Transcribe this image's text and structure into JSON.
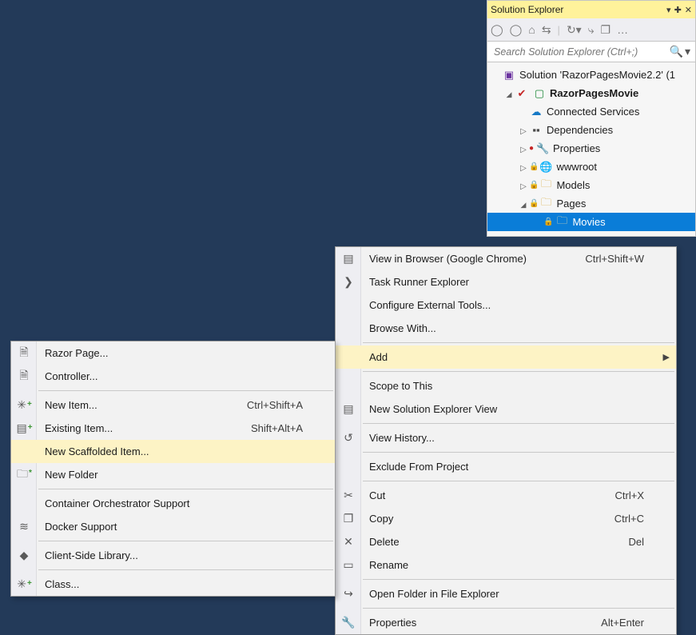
{
  "solutionExplorer": {
    "title": "Solution Explorer",
    "searchPlaceholder": "Search Solution Explorer (Ctrl+;)",
    "tree": {
      "solution": "Solution 'RazorPagesMovie2.2' (1",
      "project": "RazorPagesMovie",
      "connected": "Connected Services",
      "dependencies": "Dependencies",
      "properties": "Properties",
      "wwwroot": "wwwroot",
      "models": "Models",
      "pages": "Pages",
      "movies": "Movies"
    }
  },
  "contextMenu": {
    "viewInBrowser": "View in Browser (Google Chrome)",
    "viewInBrowser_short": "Ctrl+Shift+W",
    "taskRunner": "Task Runner Explorer",
    "configureExternal": "Configure External Tools...",
    "browseWith": "Browse With...",
    "add": "Add",
    "scope": "Scope to This",
    "newSolExplorer": "New Solution Explorer View",
    "viewHistory": "View History...",
    "excludeFromProject": "Exclude From Project",
    "cut": "Cut",
    "cut_short": "Ctrl+X",
    "copy": "Copy",
    "copy_short": "Ctrl+C",
    "delete": "Delete",
    "delete_short": "Del",
    "rename": "Rename",
    "openInExplorer": "Open Folder in File Explorer",
    "properties": "Properties",
    "properties_short": "Alt+Enter"
  },
  "addSub": {
    "razorPage": "Razor Page...",
    "controller": "Controller...",
    "newItem": "New Item...",
    "newItem_short": "Ctrl+Shift+A",
    "existingItem": "Existing Item...",
    "existingItem_short": "Shift+Alt+A",
    "newScaffolded": "New Scaffolded Item...",
    "newFolder": "New Folder",
    "containerOrch": "Container Orchestrator Support",
    "dockerSupport": "Docker Support",
    "clientSideLib": "Client-Side Library...",
    "class": "Class..."
  }
}
